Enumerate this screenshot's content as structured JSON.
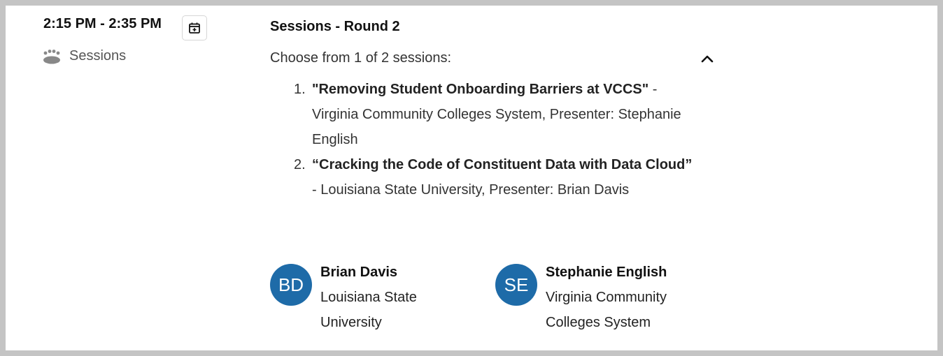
{
  "session": {
    "time_range": "2:15 PM - 2:35 PM",
    "type_label": "Sessions",
    "title": "Sessions - Round 2",
    "chooser_text": "Choose from 1 of 2 sessions:",
    "items": [
      {
        "number": "1.",
        "title": "\"Removing Student Onboarding Barriers at VCCS\"",
        "detail": " - Virginia Community Colleges System, Presenter: Stephanie English"
      },
      {
        "number": "2.",
        "title": "“Cracking the Code of Constituent Data with Data Cloud”",
        "detail": " - Louisiana State University, Presenter: Brian Davis"
      }
    ]
  },
  "speakers": [
    {
      "initials": "BD",
      "name": "Brian Davis",
      "org": "Louisiana State University"
    },
    {
      "initials": "SE",
      "name": "Stephanie English",
      "org": "Virginia Community Colleges System"
    }
  ],
  "icons": {
    "calendar": "calendar-add-icon",
    "people": "people-group-icon",
    "collapse": "chevron-up-icon"
  },
  "colors": {
    "avatar": "#1e6ba8",
    "background": "#c4c4c4"
  }
}
